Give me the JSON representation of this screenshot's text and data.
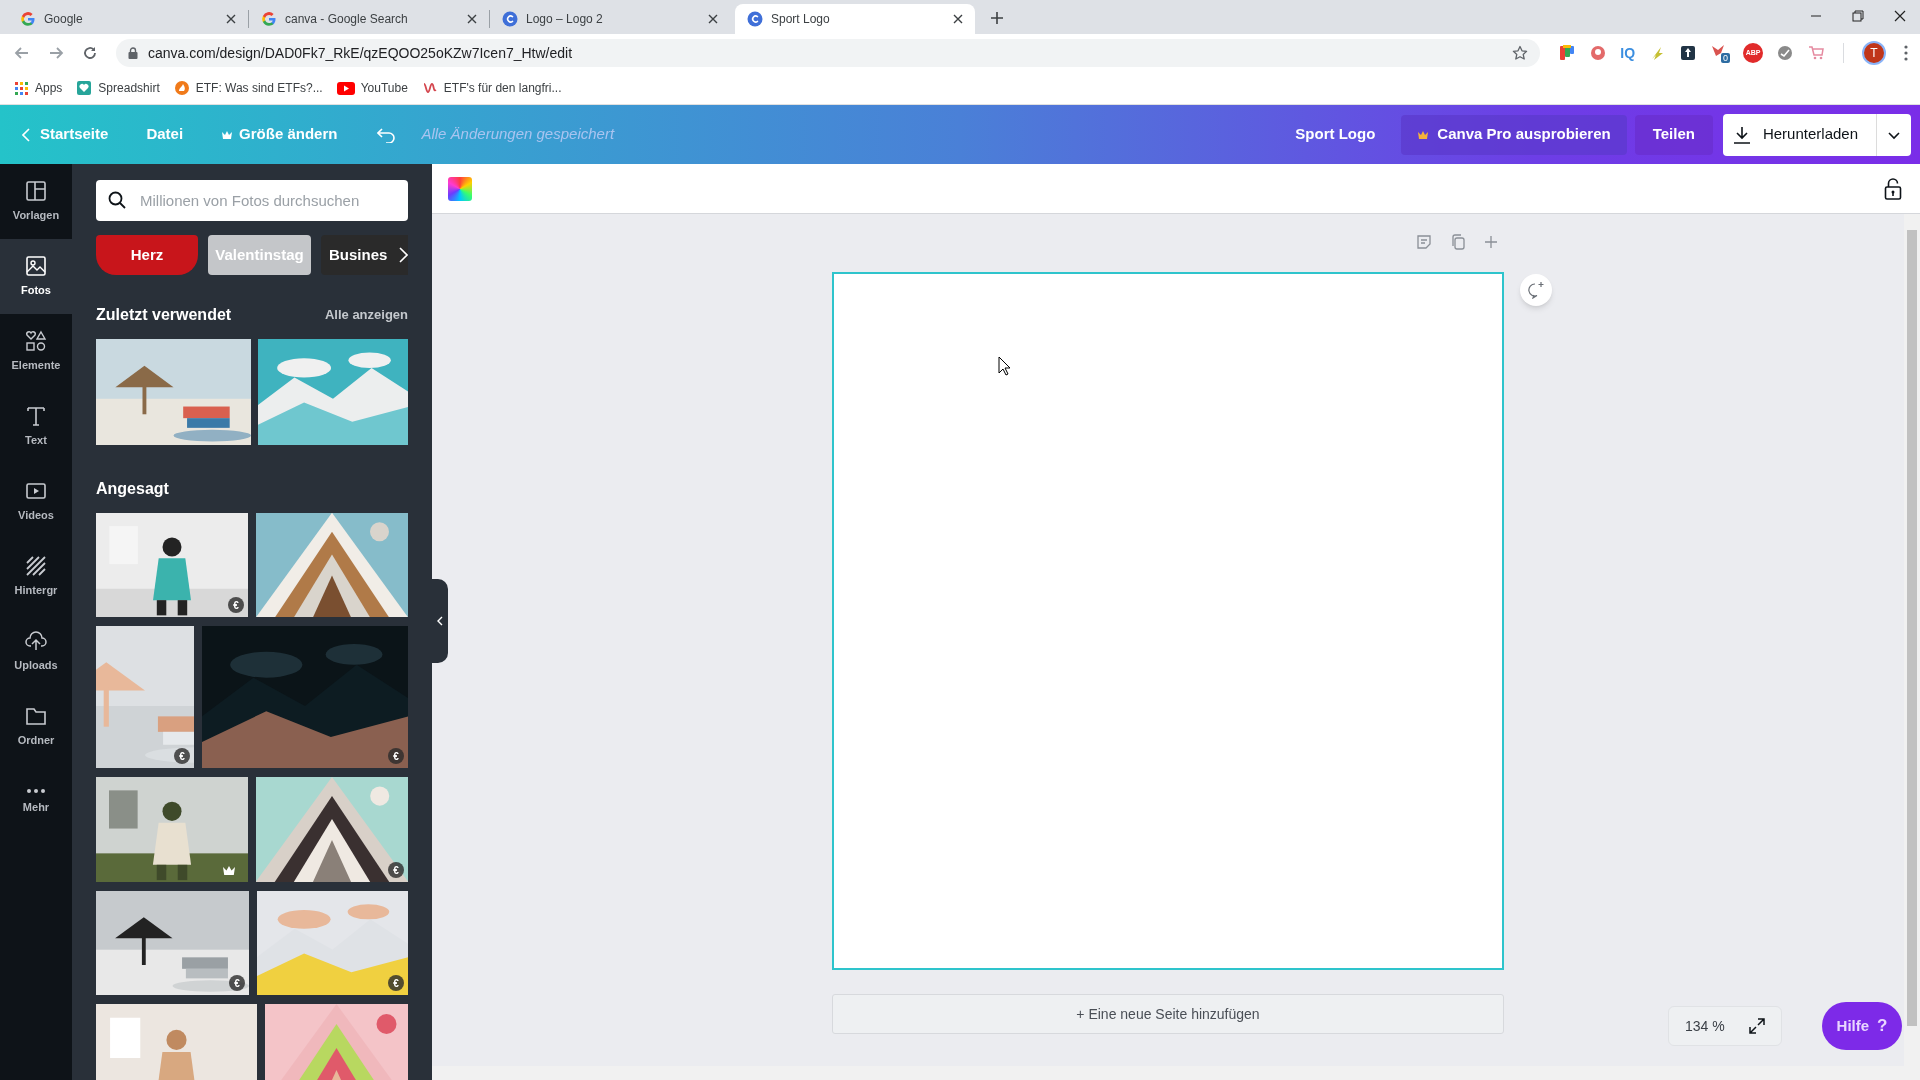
{
  "browser": {
    "tabs": [
      {
        "title": "Google",
        "kind": "google",
        "selected": false
      },
      {
        "title": "canva - Google Search",
        "kind": "google",
        "selected": false
      },
      {
        "title": "Logo – Logo 2",
        "kind": "canva",
        "selected": false
      },
      {
        "title": "Sport Logo",
        "kind": "canva",
        "selected": true
      }
    ],
    "url": "canva.com/design/DAD0Fk7_RkE/qzEQOO25oKZw7Icen7_Htw/edit",
    "extensions": [
      {
        "kind": "colorful"
      },
      {
        "kind": "round-red"
      },
      {
        "kind": "text",
        "label": "IQ"
      },
      {
        "kind": "bolt"
      },
      {
        "kind": "dark"
      },
      {
        "kind": "bird",
        "badge": "0"
      },
      {
        "kind": "stop",
        "label": "ABP"
      },
      {
        "kind": "round-grey"
      },
      {
        "kind": "cart"
      }
    ],
    "profile": "T",
    "bookmarks": [
      {
        "label": "Apps",
        "kind": "apps"
      },
      {
        "label": "Spreadshirt",
        "kind": "heart"
      },
      {
        "label": "ETF: Was sind ETFs?...",
        "kind": "orange"
      },
      {
        "label": "YouTube",
        "kind": "youtube"
      },
      {
        "label": "ETF's für den langfri...",
        "kind": "script"
      }
    ]
  },
  "header": {
    "back": "Startseite",
    "file": "Datei",
    "resize": "Größe ändern",
    "saved": "Alle Änderungen gespeichert",
    "title": "Sport Logo",
    "pro": "Canva Pro ausprobieren",
    "share": "Teilen",
    "download": "Herunterladen"
  },
  "rail": [
    {
      "label": "Vorlagen",
      "kind": "templates",
      "selected": false
    },
    {
      "label": "Fotos",
      "kind": "photos",
      "selected": true
    },
    {
      "label": "Elemente",
      "kind": "elements",
      "selected": false
    },
    {
      "label": "Text",
      "kind": "text",
      "selected": false
    },
    {
      "label": "Videos",
      "kind": "videos",
      "selected": false
    },
    {
      "label": "Hintergr",
      "kind": "background",
      "selected": false
    },
    {
      "label": "Uploads",
      "kind": "uploads",
      "selected": false
    },
    {
      "label": "Ordner",
      "kind": "folder",
      "selected": false
    },
    {
      "label": "Mehr",
      "kind": "more",
      "selected": false
    }
  ],
  "panel": {
    "search": {
      "placeholder": "Millionen von Fotos durchsuchen"
    },
    "chips": [
      "Herz",
      "Valentinstag",
      "Busines"
    ],
    "recent": {
      "title": "Zuletzt verwendet",
      "link": "Alle anzeigen",
      "photos": [
        {
          "kind": "picture"
        },
        {
          "kind": "picture"
        }
      ]
    },
    "trending": {
      "title": "Angesagt",
      "rows": [
        [
          {
            "kind": "picture",
            "badge": "€"
          },
          {
            "kind": "picture"
          }
        ],
        [
          {
            "kind": "picture",
            "badge": "€"
          },
          {
            "kind": "picture",
            "badge": "€"
          }
        ],
        [
          {
            "kind": "picture",
            "premium": true
          },
          {
            "kind": "picture",
            "badge": "€"
          }
        ],
        [
          {
            "kind": "picture",
            "badge": "€"
          },
          {
            "kind": "picture",
            "badge": "€"
          }
        ],
        [
          {
            "kind": "picture"
          },
          {
            "kind": "picture"
          }
        ]
      ]
    }
  },
  "canvas": {
    "add_page": "+ Eine neue Seite hinzufügen",
    "zoom": "134 %",
    "help": "Hilfe",
    "help_icon": "?"
  }
}
